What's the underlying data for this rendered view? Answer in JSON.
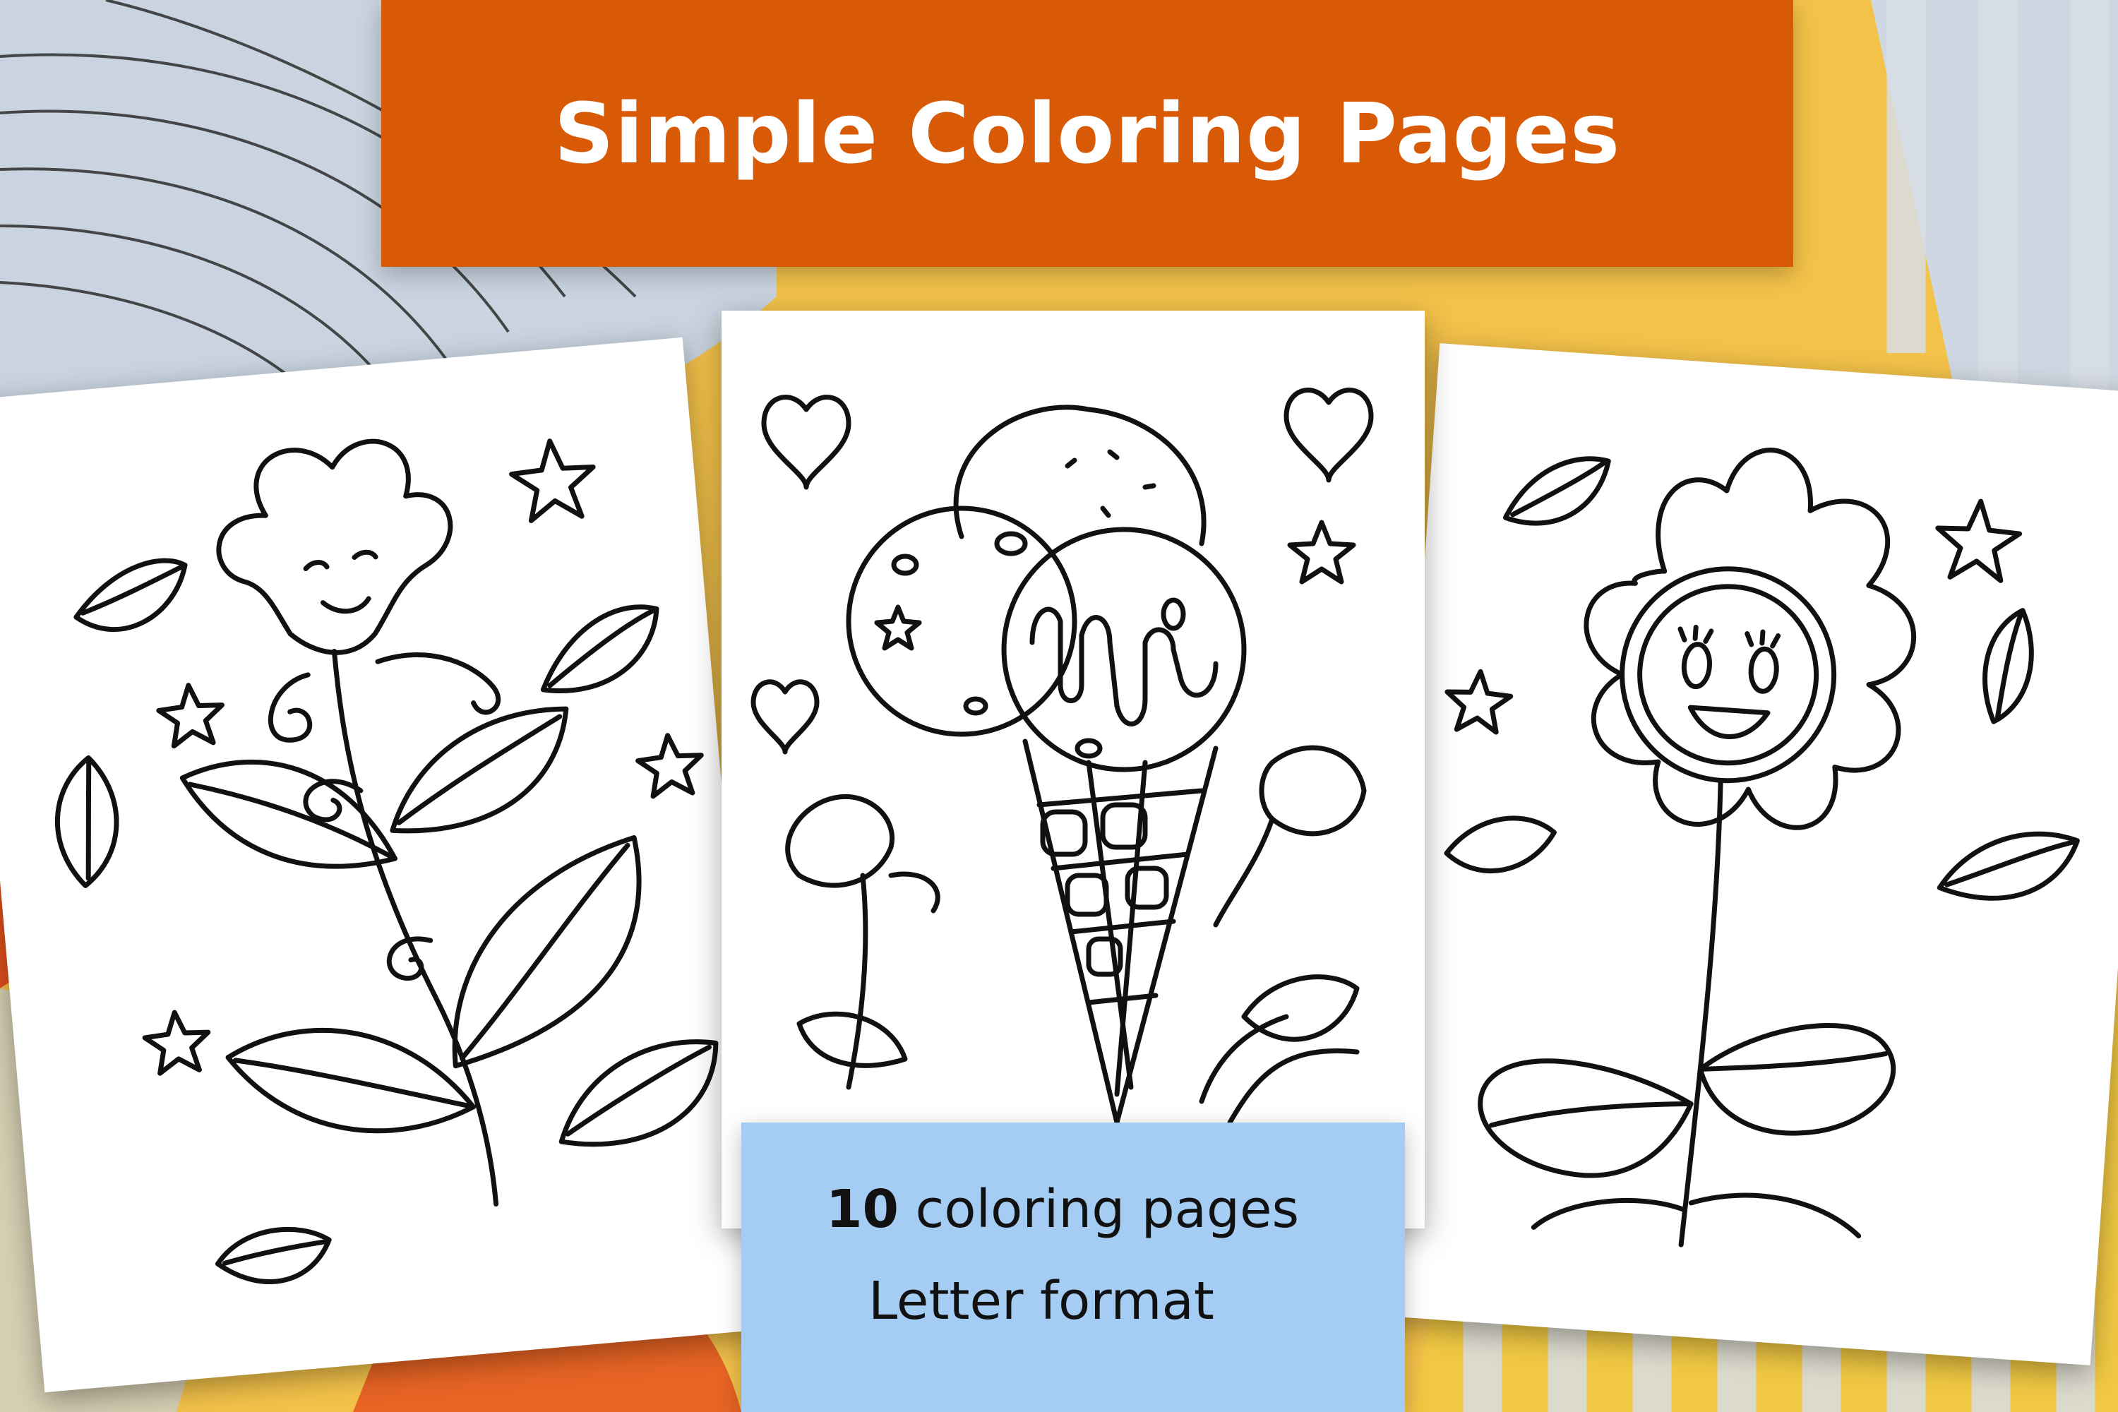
{
  "title": "Simple Coloring Pages",
  "info": {
    "count": "10",
    "count_label": "coloring pages",
    "format": "Letter format"
  },
  "colors": {
    "banner": "#d95a06",
    "info_box": "#a5cdf4",
    "background_yellow": "#f3c24a"
  },
  "pages": [
    {
      "subject": "flower-with-face-and-leaves"
    },
    {
      "subject": "ice-cream-cone-with-three-scoops"
    },
    {
      "subject": "smiling-daisy-with-leaves"
    }
  ]
}
